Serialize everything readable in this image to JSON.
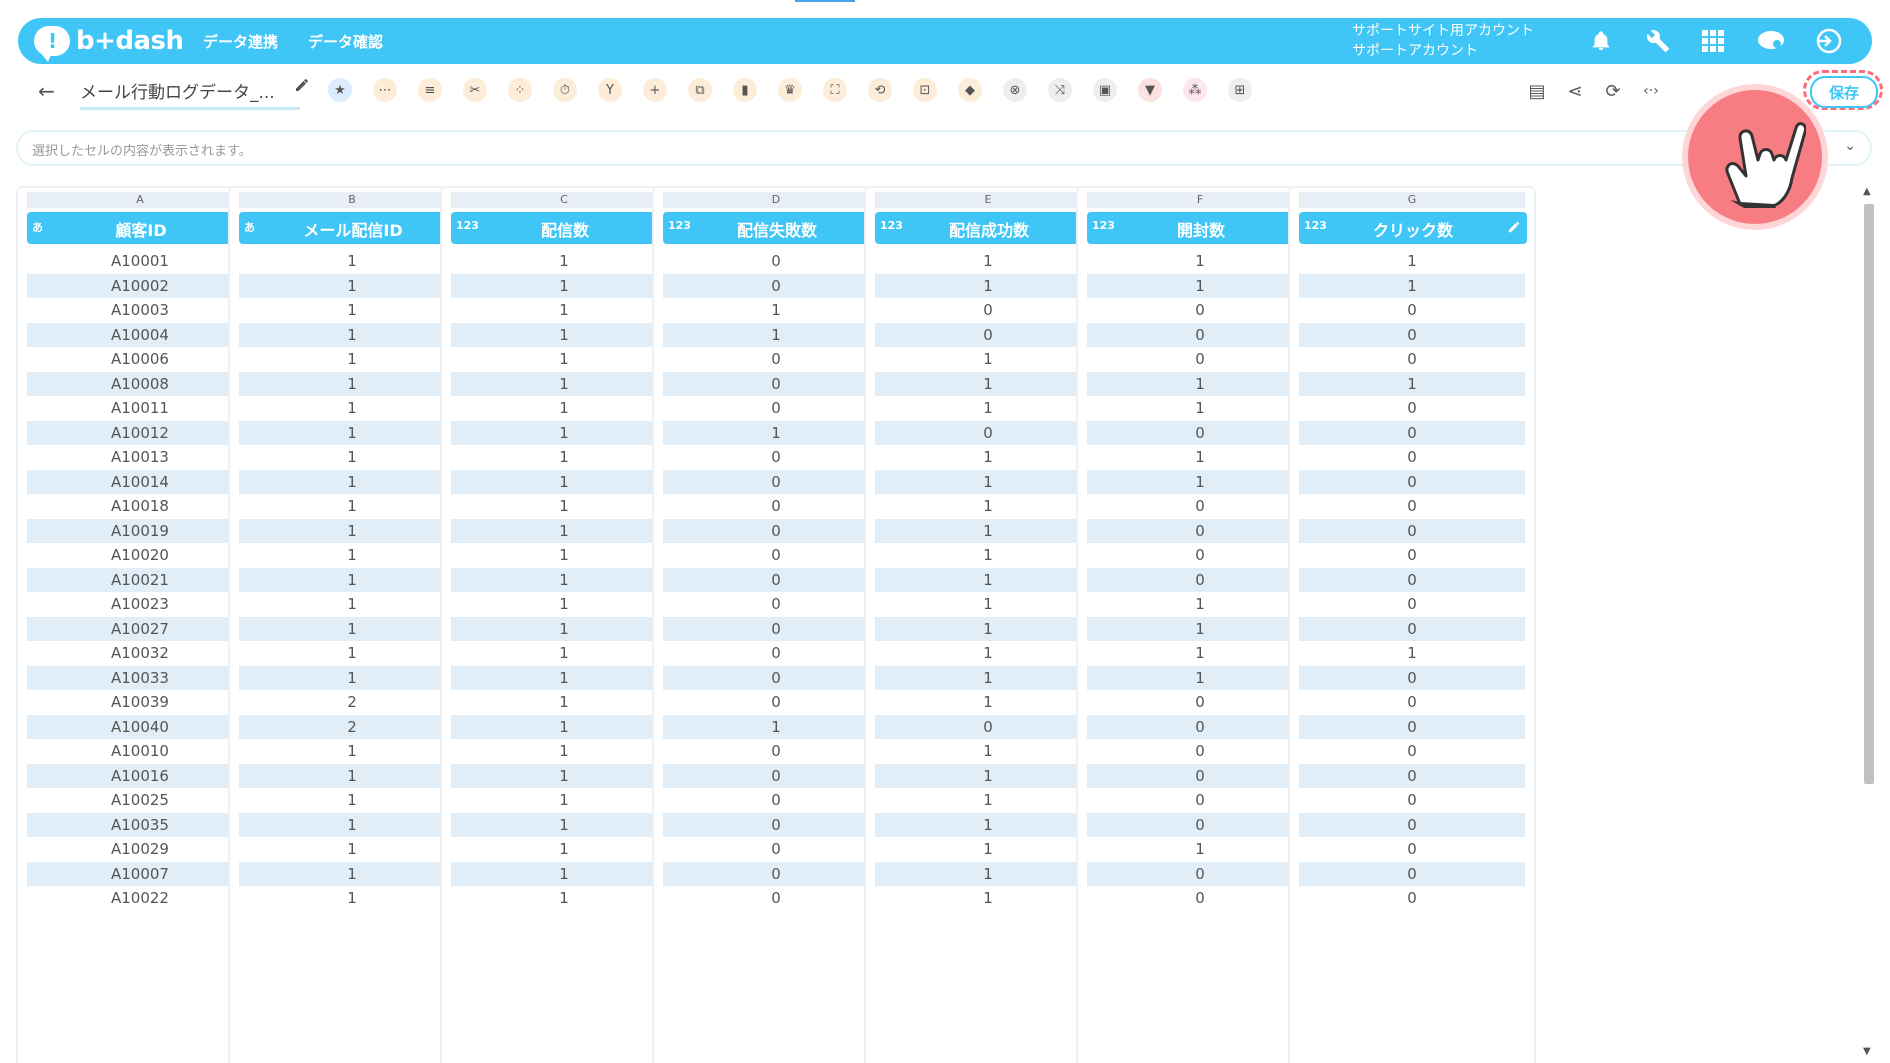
{
  "header": {
    "logo_icon": "!",
    "logo_text": "b+dash",
    "nav": [
      "データ連携",
      "データ確認"
    ],
    "account_line1": "サポートサイト用アカウント",
    "account_line2": "サポートアカウント",
    "icons": [
      "bell-icon",
      "wrench-icon",
      "apps-grid-icon",
      "cloud-chat-icon",
      "logout-icon"
    ],
    "brand_color": "#3fc6f6"
  },
  "toolbar": {
    "back_glyph": "←",
    "sheet_title": "メール行動ログデータ_...",
    "save_label": "保存",
    "right_glyphs": [
      "▤",
      "⋖",
      "⟳",
      "‹·›"
    ],
    "tool_icons": [
      "star-icon",
      "more-icon",
      "note-icon",
      "scissors-icon",
      "dots-icon",
      "timer-icon",
      "merge-icon",
      "add-icon",
      "copy-icon",
      "trash-icon",
      "crown-icon",
      "expand-icon",
      "repeat-icon",
      "lock-icon",
      "box-icon",
      "cancel-icon",
      "shuffle-icon",
      "frame-icon",
      "filter-icon",
      "group-icon",
      "table-icon"
    ]
  },
  "formula_bar": {
    "placeholder": "選択したセルの内容が表示されます。",
    "chevron": "⌄"
  },
  "table": {
    "letters": [
      "A",
      "B",
      "C",
      "D",
      "E",
      "F",
      "G"
    ],
    "columns": [
      {
        "type": "あ",
        "name": "顧客ID"
      },
      {
        "type": "あ",
        "name": "メール配信ID"
      },
      {
        "type": "123",
        "name": "配信数"
      },
      {
        "type": "123",
        "name": "配信失敗数"
      },
      {
        "type": "123",
        "name": "配信成功数"
      },
      {
        "type": "123",
        "name": "開封数"
      },
      {
        "type": "123",
        "name": "クリック数"
      }
    ],
    "rows": [
      [
        "A10001",
        "1",
        "1",
        "0",
        "1",
        "1",
        "1"
      ],
      [
        "A10002",
        "1",
        "1",
        "0",
        "1",
        "1",
        "1"
      ],
      [
        "A10003",
        "1",
        "1",
        "1",
        "0",
        "0",
        "0"
      ],
      [
        "A10004",
        "1",
        "1",
        "1",
        "0",
        "0",
        "0"
      ],
      [
        "A10006",
        "1",
        "1",
        "0",
        "1",
        "0",
        "0"
      ],
      [
        "A10008",
        "1",
        "1",
        "0",
        "1",
        "1",
        "1"
      ],
      [
        "A10011",
        "1",
        "1",
        "0",
        "1",
        "1",
        "0"
      ],
      [
        "A10012",
        "1",
        "1",
        "1",
        "0",
        "0",
        "0"
      ],
      [
        "A10013",
        "1",
        "1",
        "0",
        "1",
        "1",
        "0"
      ],
      [
        "A10014",
        "1",
        "1",
        "0",
        "1",
        "1",
        "0"
      ],
      [
        "A10018",
        "1",
        "1",
        "0",
        "1",
        "0",
        "0"
      ],
      [
        "A10019",
        "1",
        "1",
        "0",
        "1",
        "0",
        "0"
      ],
      [
        "A10020",
        "1",
        "1",
        "0",
        "1",
        "0",
        "0"
      ],
      [
        "A10021",
        "1",
        "1",
        "0",
        "1",
        "0",
        "0"
      ],
      [
        "A10023",
        "1",
        "1",
        "0",
        "1",
        "1",
        "0"
      ],
      [
        "A10027",
        "1",
        "1",
        "0",
        "1",
        "1",
        "0"
      ],
      [
        "A10032",
        "1",
        "1",
        "0",
        "1",
        "1",
        "1"
      ],
      [
        "A10033",
        "1",
        "1",
        "0",
        "1",
        "1",
        "0"
      ],
      [
        "A10039",
        "2",
        "1",
        "0",
        "1",
        "0",
        "0"
      ],
      [
        "A10040",
        "2",
        "1",
        "1",
        "0",
        "0",
        "0"
      ],
      [
        "A10010",
        "1",
        "1",
        "0",
        "1",
        "0",
        "0"
      ],
      [
        "A10016",
        "1",
        "1",
        "0",
        "1",
        "0",
        "0"
      ],
      [
        "A10025",
        "1",
        "1",
        "0",
        "1",
        "0",
        "0"
      ],
      [
        "A10035",
        "1",
        "1",
        "0",
        "1",
        "0",
        "0"
      ],
      [
        "A10029",
        "1",
        "1",
        "0",
        "1",
        "1",
        "0"
      ],
      [
        "A10007",
        "1",
        "1",
        "0",
        "1",
        "0",
        "0"
      ],
      [
        "A10022",
        "1",
        "1",
        "0",
        "1",
        "0",
        "0"
      ]
    ]
  },
  "scrollbar": {
    "up": "▲",
    "down": "▼"
  },
  "pointer": {
    "icon": "pointing-hand-icon",
    "color": "#f77d82"
  }
}
